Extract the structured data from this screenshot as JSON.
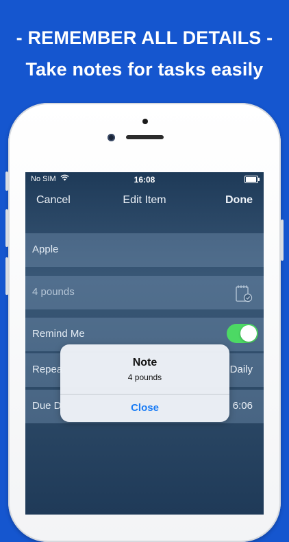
{
  "promo": {
    "headline": "- REMEMBER ALL DETAILS -",
    "subheadline": "Take notes for tasks easily"
  },
  "status_bar": {
    "carrier": "No SIM",
    "wifi_icon": "wifi-icon",
    "time": "16:08",
    "battery_icon": "battery-icon"
  },
  "nav": {
    "cancel_label": "Cancel",
    "title": "Edit Item",
    "done_label": "Done"
  },
  "form": {
    "item_name": "Apple",
    "note": "4 pounds",
    "note_icon": "notepad-check-icon",
    "remind_label": "Remind Me",
    "remind_on": true,
    "repeat_label": "Repea",
    "repeat_value": "Daily",
    "due_label": "Due D",
    "due_value": "6:06"
  },
  "dialog": {
    "title": "Note",
    "message": "4 pounds",
    "close_label": "Close"
  },
  "colors": {
    "background": "#1556cf",
    "toggle_on": "#4cd964",
    "dialog_button": "#1a7cf5"
  }
}
